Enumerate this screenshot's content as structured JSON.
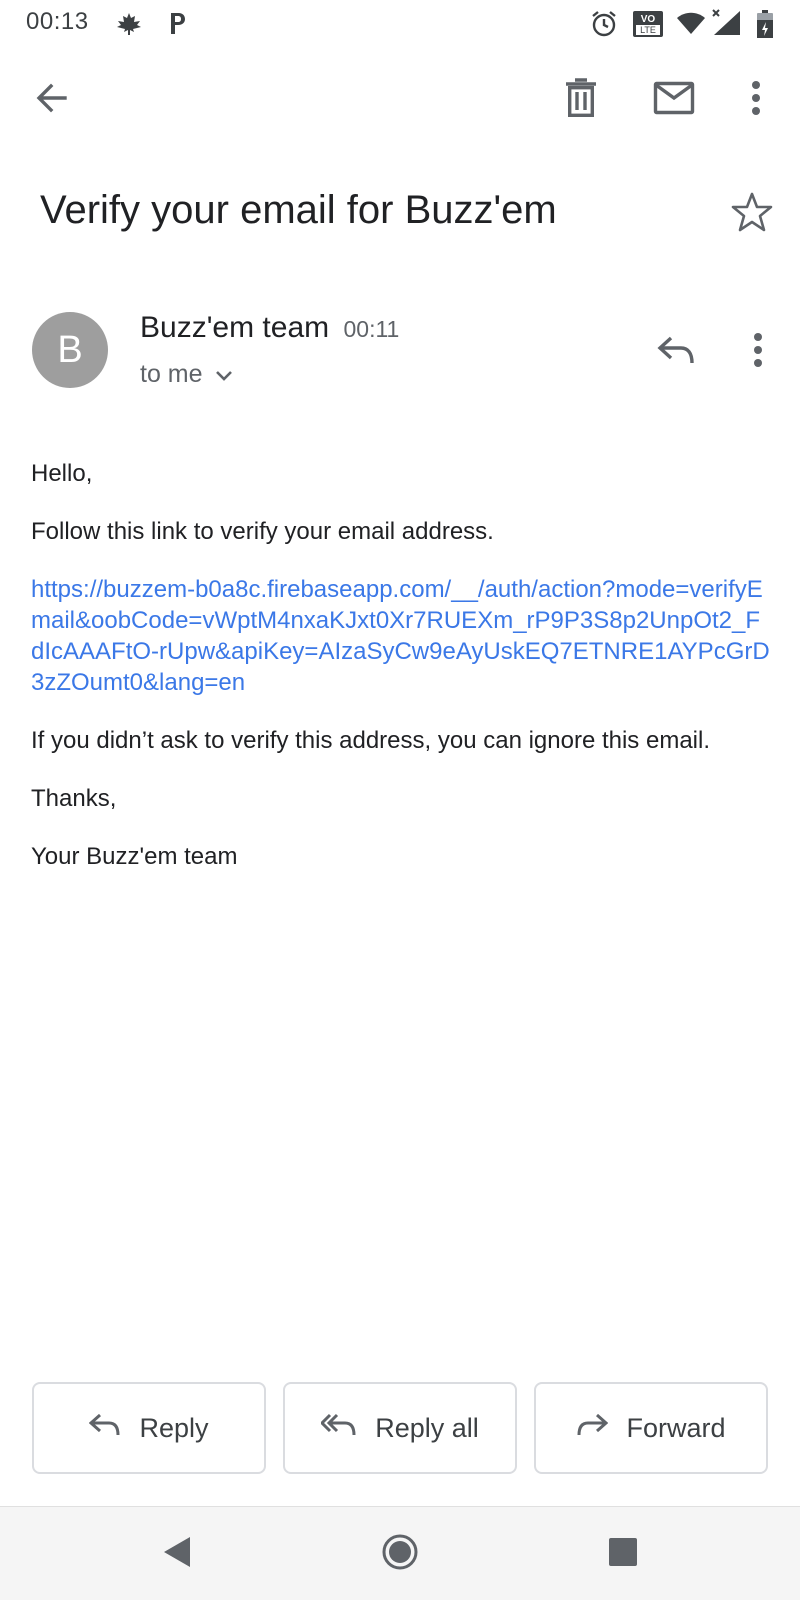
{
  "status_bar": {
    "time": "00:13",
    "icons": [
      "maple-leaf-icon",
      "parking-icon",
      "alarm-icon",
      "volte-icon",
      "wifi-icon",
      "signal-icon",
      "battery-charging-icon"
    ],
    "volte_label_top": "VO",
    "volte_label_bottom": "LTE"
  },
  "toolbar": {
    "back_icon": "arrow-left-icon",
    "delete_icon": "trash-icon",
    "mark_unread_icon": "mail-icon",
    "more_icon": "more-vertical-icon"
  },
  "message": {
    "subject": "Verify your email for Buzz'em",
    "star_icon": "star-outline-icon",
    "sender": {
      "avatar_letter": "B",
      "name": "Buzz'em team",
      "time": "00:11",
      "recipient": "to me"
    },
    "body": {
      "greeting": "Hello,",
      "instruction": "Follow this link to verify your email address.",
      "link": "https://buzzem-b0a8c.firebaseapp.com/__/auth/action?mode=verifyEmail&oobCode=vWptM4nxaKJxt0Xr7RUEXm_rP9P3S8p2UnpOt2_FdIcAAAFtO-rUpw&apiKey=AIzaSyCw9eAyUskEQ7ETNRE1AYPcGrD3zZOumt0&lang=en",
      "ignore_note": "If you didn’t ask to verify this address, you can ignore this email.",
      "thanks": "Thanks,",
      "signature": "Your Buzz'em team"
    }
  },
  "actions": {
    "reply": "Reply",
    "reply_all": "Reply all",
    "forward": "Forward"
  },
  "colors": {
    "link": "#3b78e7",
    "avatar": "#9e9e9e",
    "icon": "#5f6368",
    "text": "#202124"
  }
}
